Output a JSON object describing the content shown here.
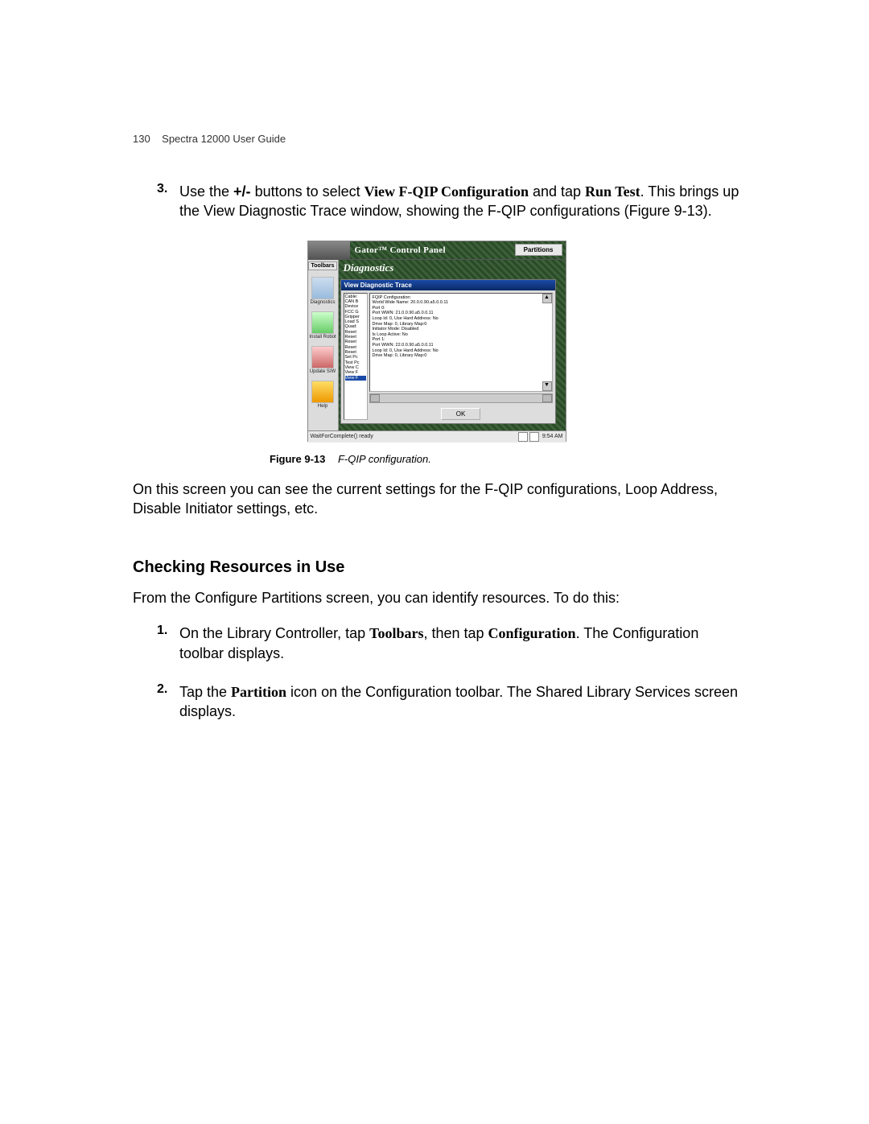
{
  "header": {
    "page_num": "130",
    "doc_title": "Spectra 12000 User Guide"
  },
  "step3": {
    "num": "3.",
    "t1": "Use the ",
    "plusminus": "+/-",
    "t2": " buttons to select ",
    "ui1": "View F-QIP Configuration",
    "t3": " and tap ",
    "ui2": "Run Test",
    "t4": ". This brings up the View Diagnostic Trace window, showing the F-QIP configurations (Figure 9-13)."
  },
  "screenshot": {
    "title": "Gator™ Control Panel",
    "partitions_btn": "Partitions",
    "toolbars_btn": "Toolbars",
    "sidebar": {
      "diagnostics": "Diagnostics",
      "install": "Install Robot",
      "update": "Update S/W",
      "help": "Help"
    },
    "diag_banner": "Diagnostics",
    "dialog": {
      "title": "View Diagnostic Trace",
      "list": [
        "Cable:",
        "CAN B",
        "Device",
        "FCC G",
        "Gripper",
        "Load S",
        "Quad:",
        "Reset",
        "Reset",
        "Reset",
        "Reset",
        "Reset",
        "Set Pc",
        "Test Pc",
        "View C",
        "View F",
        "View F"
      ],
      "trace": [
        "FQIP Configuration:",
        "World Wide Name: 20.0.0.90.a5.0.0.11",
        "Port 0:",
        "Port WWN: 21.0.0.90.a5.0.0.11",
        "Loop Id: 0, Use Hard Address: No",
        "Drive Map: 0, Library Map:0",
        "Initiator Mode: Disabled",
        "Is Loop Active: No",
        "Port 1:",
        "Port WWN: 22.0.0.90.a5.0.0.11",
        "Loop Id: 0, Use Hard Address: No",
        "Drive Map: 0, Library Map:0"
      ],
      "ok": "OK"
    },
    "status": {
      "text": "WaitForComplete() ready",
      "time": "9:54 AM"
    }
  },
  "figure": {
    "label": "Figure 9-13",
    "caption": "F-QIP configuration."
  },
  "after_figure": "On this screen you can see the current settings for the F-QIP configurations, Loop Address, Disable Initiator settings, etc.",
  "section_heading": "Checking Resources in Use",
  "section_intro": "From the Configure Partitions screen, you can identify resources. To do this:",
  "step1": {
    "num": "1.",
    "t1": "On the Library Controller, tap ",
    "ui1": "Toolbars",
    "t2": ", then tap ",
    "ui2": "Configuration",
    "t3": ". The Configuration toolbar displays."
  },
  "step2": {
    "num": "2.",
    "t1": "Tap the ",
    "ui1": "Partition",
    "t2": " icon on the Configuration toolbar. The Shared Library Services screen displays."
  }
}
